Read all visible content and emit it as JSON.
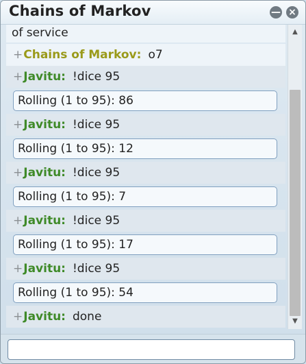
{
  "window": {
    "title": "Chains of Markov"
  },
  "icons": {
    "minimize": "minimize-icon",
    "close": "close-icon",
    "scroll_up": "scroll-up-icon",
    "scroll_down": "scroll-down-icon"
  },
  "colors": {
    "self_nick": "#9a9a1a",
    "user_nick": "#3f8a28"
  },
  "log": {
    "partial_line": "of service",
    "messages": [
      {
        "plus": "+",
        "nick": "Chains of Markov:",
        "text": "o7"
      },
      {
        "plus": "+",
        "nick": "Javitu:",
        "text": "!dice 95",
        "reply": "Rolling (1 to 95): 86"
      },
      {
        "plus": "+",
        "nick": "Javitu:",
        "text": "!dice 95",
        "reply": "Rolling (1 to 95): 12"
      },
      {
        "plus": "+",
        "nick": "Javitu:",
        "text": "!dice 95",
        "reply": "Rolling (1 to 95): 7"
      },
      {
        "plus": "+",
        "nick": "Javitu:",
        "text": "!dice 95",
        "reply": "Rolling (1 to 95): 17"
      },
      {
        "plus": "+",
        "nick": "Javitu:",
        "text": "!dice 95",
        "reply": "Rolling (1 to 95): 54"
      },
      {
        "plus": "+",
        "nick": "Javitu:",
        "text": "done"
      }
    ]
  },
  "input": {
    "value": "",
    "placeholder": ""
  }
}
